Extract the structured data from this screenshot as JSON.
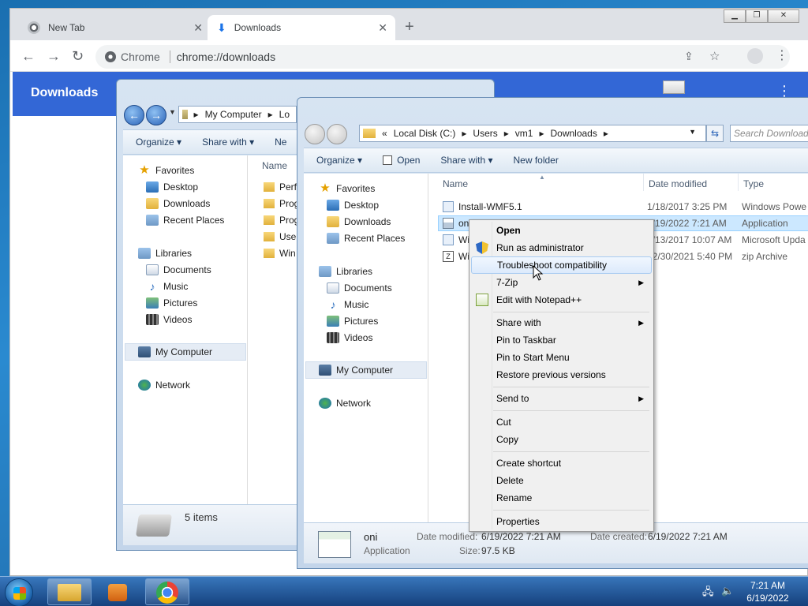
{
  "browser": {
    "tabs": [
      {
        "label": "New Tab",
        "active": false
      },
      {
        "label": "Downloads",
        "active": true
      }
    ],
    "address": {
      "host": "Chrome",
      "path": "chrome://downloads"
    },
    "page_title": "Downloads"
  },
  "explorer_back": {
    "address_crumbs": [
      "My Computer",
      "Lo"
    ],
    "toolbar": {
      "organize": "Organize",
      "share_with": "Share with",
      "new": "Ne"
    },
    "column_name": "Name",
    "files": [
      "Perf",
      "Prog",
      "Prog",
      "User",
      "Win"
    ],
    "status": "5 items",
    "nav": {
      "favorites": "Favorites",
      "desktop": "Desktop",
      "downloads": "Downloads",
      "recent": "Recent Places",
      "libraries": "Libraries",
      "documents": "Documents",
      "music": "Music",
      "pictures": "Pictures",
      "videos": "Videos",
      "computer": "My Computer",
      "network": "Network"
    }
  },
  "explorer_front": {
    "address_crumbs": [
      "«",
      "Local Disk (C:)",
      "Users",
      "vm1",
      "Downloads"
    ],
    "search_placeholder": "Search Downloads",
    "toolbar": {
      "organize": "Organize",
      "open": "Open",
      "share_with": "Share with",
      "new_folder": "New folder"
    },
    "columns": {
      "name": "Name",
      "date": "Date modified",
      "type": "Type"
    },
    "files": [
      {
        "name": "Install-WMF5.1",
        "date": "1/18/2017 3:25 PM",
        "type": "Windows Powe"
      },
      {
        "name": "oni",
        "date": "6/19/2022 7:21 AM",
        "type": "Application"
      },
      {
        "name": "Wi",
        "date": "2/13/2017 10:07 AM",
        "type": "Microsoft Upda"
      },
      {
        "name": "Wi",
        "date": "12/30/2021 5:40 PM",
        "type": "zip Archive"
      }
    ],
    "nav": {
      "favorites": "Favorites",
      "desktop": "Desktop",
      "downloads": "Downloads",
      "recent": "Recent Places",
      "libraries": "Libraries",
      "documents": "Documents",
      "music": "Music",
      "pictures": "Pictures",
      "videos": "Videos",
      "computer": "My Computer",
      "network": "Network"
    },
    "details": {
      "name": "oni",
      "kind": "Application",
      "date_modified_label": "Date modified:",
      "date_modified": "6/19/2022 7:21 AM",
      "date_created_label": "Date created:",
      "date_created": "6/19/2022 7:21 AM",
      "size_label": "Size:",
      "size": "97.5 KB"
    }
  },
  "context_menu": {
    "items": [
      {
        "label": "Open"
      },
      {
        "label": "Run as administrator"
      },
      {
        "label": "Troubleshoot compatibility"
      },
      {
        "label": "7-Zip"
      },
      {
        "label": "Edit with Notepad++"
      },
      {
        "label": "Share with"
      },
      {
        "label": "Pin to Taskbar"
      },
      {
        "label": "Pin to Start Menu"
      },
      {
        "label": "Restore previous versions"
      },
      {
        "label": "Send to"
      },
      {
        "label": "Cut"
      },
      {
        "label": "Copy"
      },
      {
        "label": "Create shortcut"
      },
      {
        "label": "Delete"
      },
      {
        "label": "Rename"
      },
      {
        "label": "Properties"
      }
    ]
  },
  "taskbar": {
    "time": "7:21 AM",
    "date": "6/19/2022"
  },
  "colors": {
    "chrome_blue": "#3367d6",
    "selection": "#cce8ff"
  }
}
